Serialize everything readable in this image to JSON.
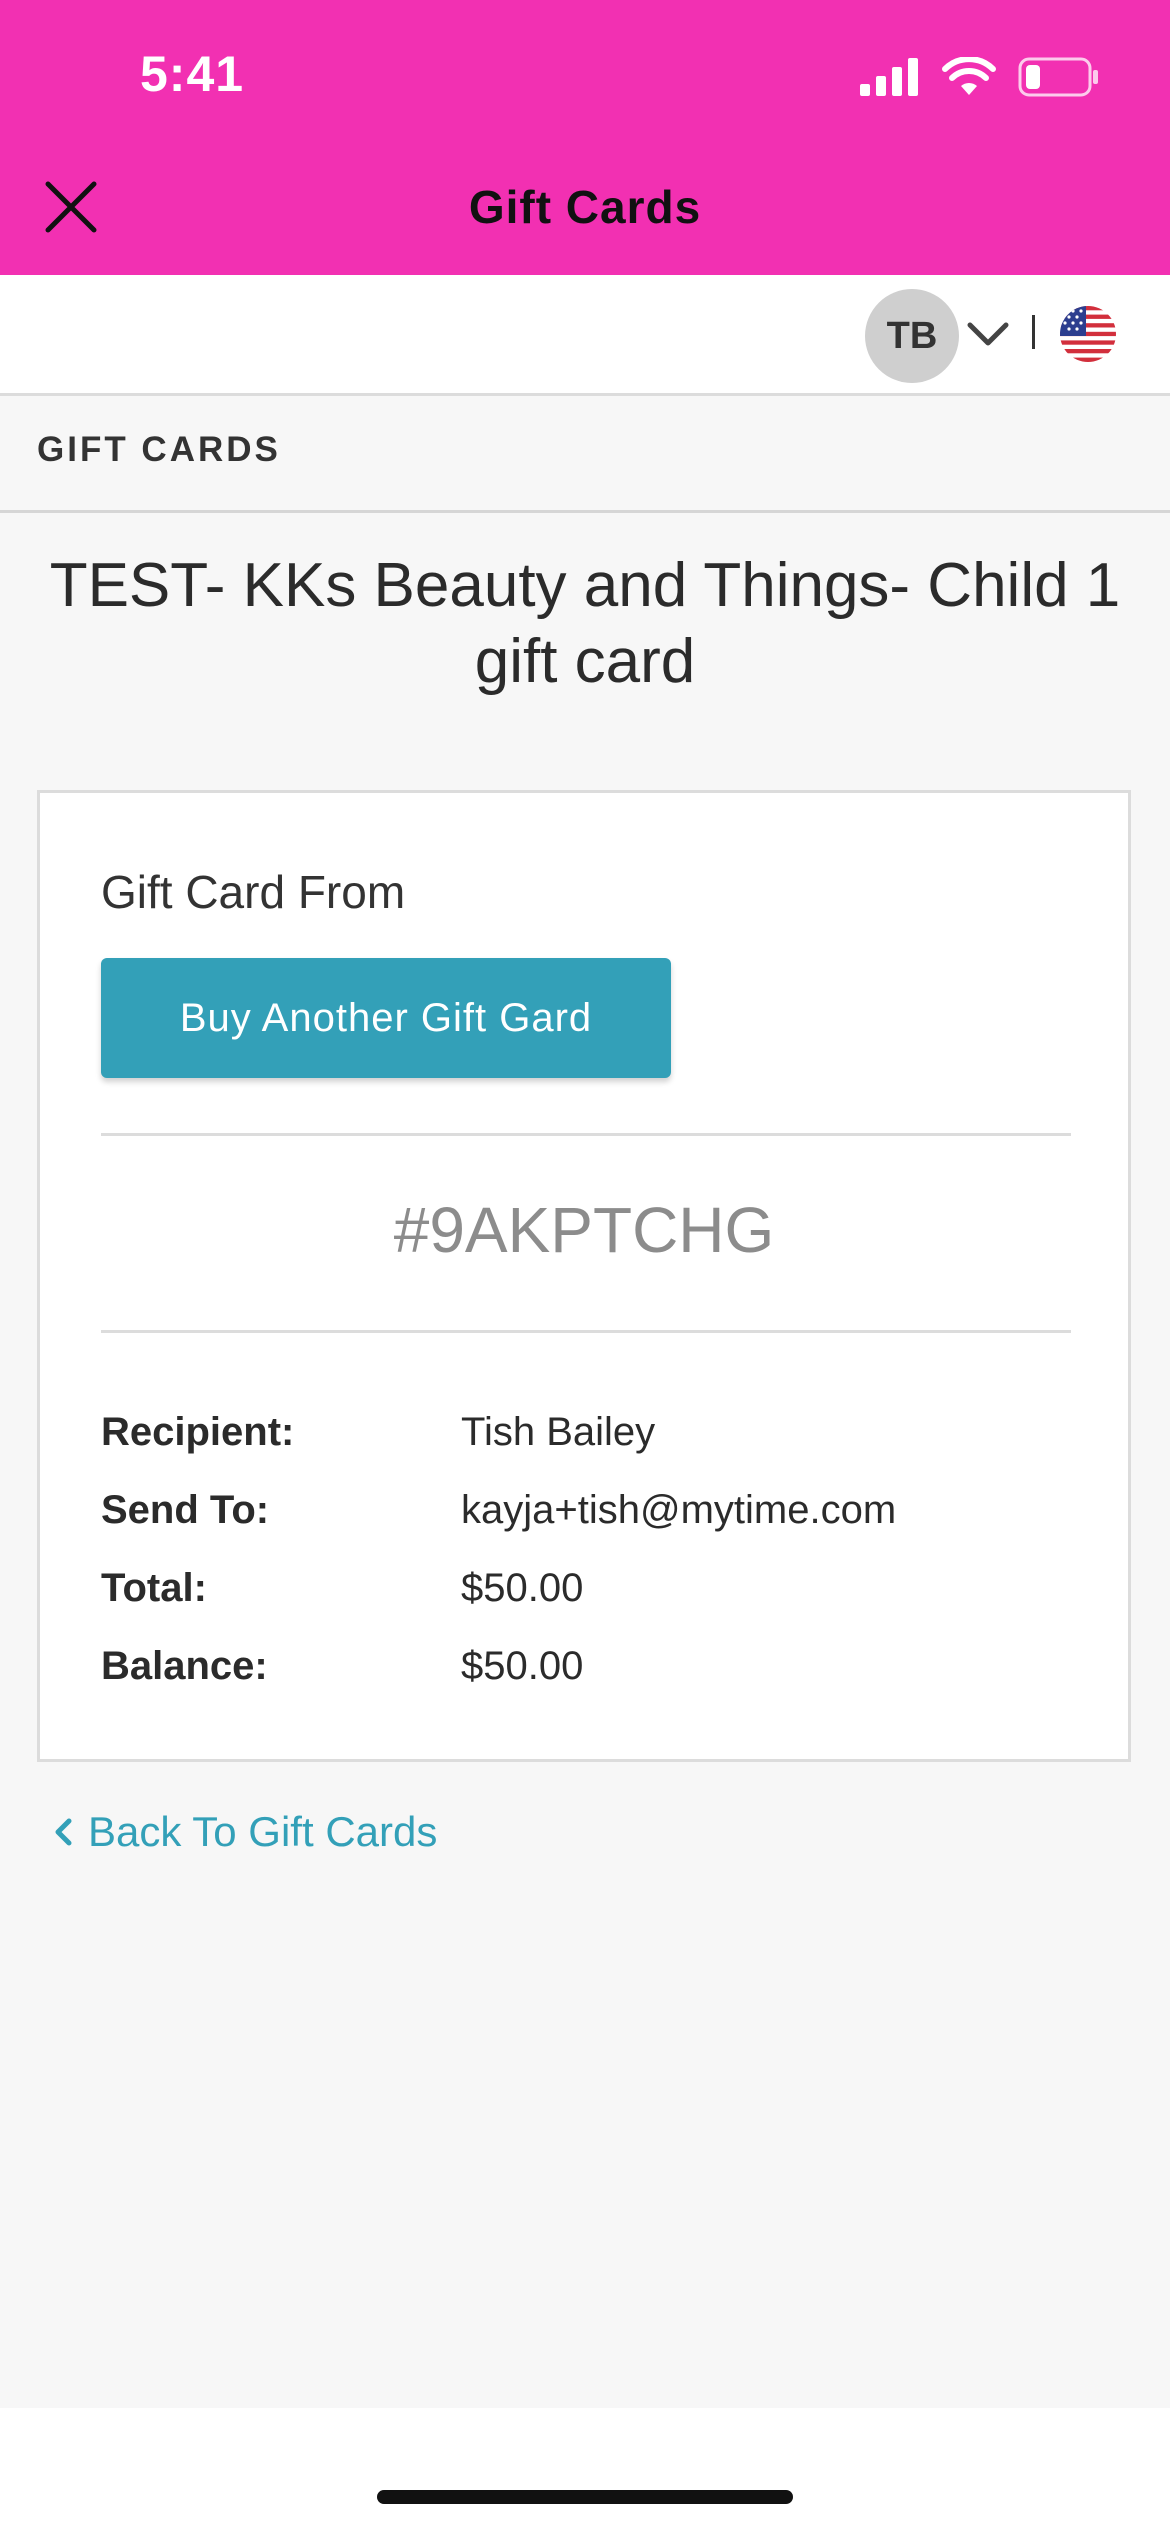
{
  "status_bar": {
    "time": "5:41"
  },
  "header": {
    "title": "Gift Cards",
    "close_icon": "close-icon"
  },
  "account": {
    "initials": "TB",
    "chevron_icon": "chevron-down-icon",
    "flag_icon": "us-flag-icon"
  },
  "section": {
    "label": "GIFT CARDS"
  },
  "page": {
    "title": "TEST- KKs Beauty and Things- Child 1 gift card"
  },
  "card": {
    "from_label": "Gift Card From",
    "buy_button_label": "Buy Another Gift Gard",
    "code": "#9AKPTCHG",
    "details": [
      {
        "key": "Recipient:",
        "value": "Tish Bailey"
      },
      {
        "key": "Send To:",
        "value": "kayja+tish@mytime.com"
      },
      {
        "key": "Total:",
        "value": "$50.00"
      },
      {
        "key": "Balance:",
        "value": "$50.00"
      }
    ]
  },
  "back_link": {
    "label": "Back To Gift Cards",
    "icon": "chevron-left-icon"
  },
  "colors": {
    "header_bg": "#f230b2",
    "accent": "#33a0b8",
    "page_bg": "#f7f7f7"
  }
}
